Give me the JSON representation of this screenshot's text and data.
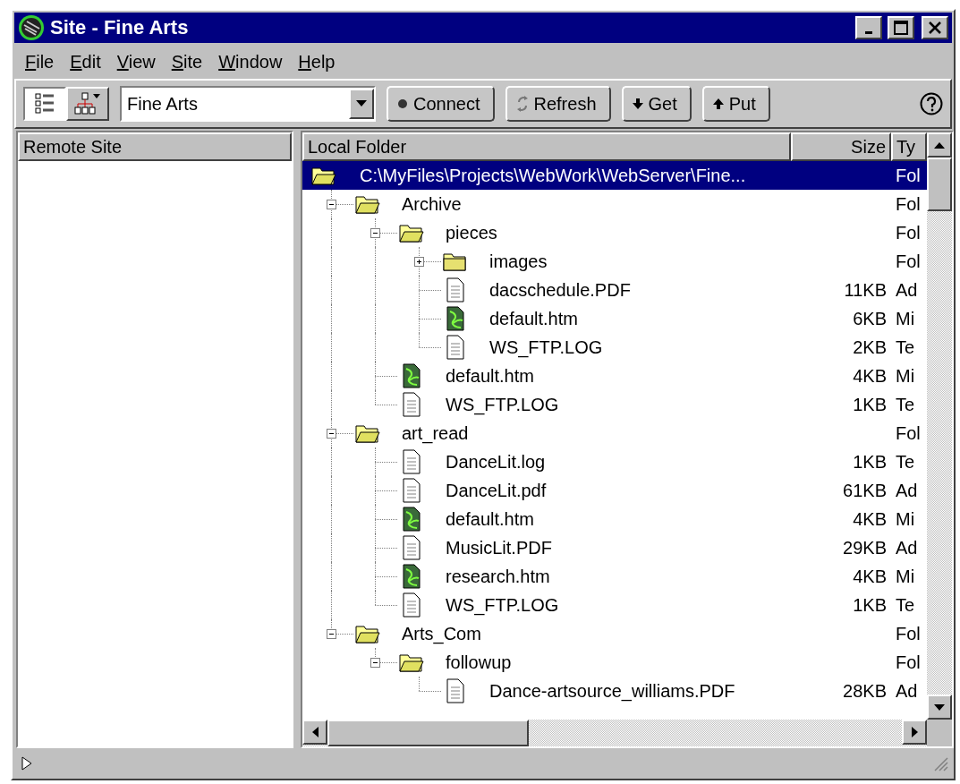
{
  "window": {
    "title": "Site - Fine Arts"
  },
  "menu": [
    {
      "label": "File"
    },
    {
      "label": "Edit"
    },
    {
      "label": "View"
    },
    {
      "label": "Site"
    },
    {
      "label": "Window"
    },
    {
      "label": "Help"
    }
  ],
  "toolbar": {
    "views": [
      {
        "kind": "list",
        "selected": true
      },
      {
        "kind": "tree",
        "selected": false
      }
    ],
    "site": "Fine Arts",
    "buttons": [
      {
        "kind": "connect",
        "label": "Connect"
      },
      {
        "kind": "refresh",
        "label": "Refresh"
      },
      {
        "kind": "get",
        "label": "Get"
      },
      {
        "kind": "put",
        "label": "Put"
      }
    ]
  },
  "remote_pane": {
    "header": "Remote Site"
  },
  "local_pane": {
    "columns": [
      "Local Folder",
      "Size",
      "Ty"
    ],
    "tree": [
      {
        "name": "C:\\MyFiles\\Projects\\WebWork\\WebServer\\Fine...",
        "type": "Fol",
        "kind": "folder",
        "selected": true,
        "expanded": true,
        "children": [
          {
            "name": "Archive",
            "type": "Fol",
            "kind": "folder",
            "selected": false,
            "expanded": true,
            "children": [
              {
                "name": "pieces",
                "type": "Fol",
                "kind": "folder",
                "selected": false,
                "expanded": true,
                "children": [
                  {
                    "name": "images",
                    "type": "Fol",
                    "kind": "folder",
                    "selected": false,
                    "expanded": false
                  },
                  {
                    "name": "dacschedule.PDF",
                    "size": "11KB",
                    "type": "Ad",
                    "kind": "file",
                    "selected": false
                  },
                  {
                    "name": "default.htm",
                    "size": "6KB",
                    "type": "Mi",
                    "kind": "html",
                    "selected": false
                  },
                  {
                    "name": "WS_FTP.LOG",
                    "size": "2KB",
                    "type": "Te",
                    "kind": "file",
                    "selected": false
                  }
                ]
              },
              {
                "name": "default.htm",
                "size": "4KB",
                "type": "Mi",
                "kind": "html",
                "selected": false
              },
              {
                "name": "WS_FTP.LOG",
                "size": "1KB",
                "type": "Te",
                "kind": "file",
                "selected": false
              }
            ]
          },
          {
            "name": "art_read",
            "type": "Fol",
            "kind": "folder",
            "selected": false,
            "expanded": true,
            "children": [
              {
                "name": "DanceLit.log",
                "size": "1KB",
                "type": "Te",
                "kind": "file",
                "selected": false
              },
              {
                "name": "DanceLit.pdf",
                "size": "61KB",
                "type": "Ad",
                "kind": "file",
                "selected": false
              },
              {
                "name": "default.htm",
                "size": "4KB",
                "type": "Mi",
                "kind": "html",
                "selected": false
              },
              {
                "name": "MusicLit.PDF",
                "size": "29KB",
                "type": "Ad",
                "kind": "file",
                "selected": false
              },
              {
                "name": "research.htm",
                "size": "4KB",
                "type": "Mi",
                "kind": "html",
                "selected": false
              },
              {
                "name": "WS_FTP.LOG",
                "size": "1KB",
                "type": "Te",
                "kind": "file",
                "selected": false
              }
            ]
          },
          {
            "name": "Arts_Com",
            "type": "Fol",
            "kind": "folder",
            "selected": false,
            "expanded": true,
            "children": [
              {
                "name": "followup",
                "type": "Fol",
                "kind": "folder",
                "selected": false,
                "expanded": true,
                "children": [
                  {
                    "name": "Dance-artsource_williams.PDF",
                    "size": "28KB",
                    "type": "Ad",
                    "kind": "file",
                    "selected": false
                  }
                ]
              }
            ]
          }
        ]
      }
    ]
  }
}
